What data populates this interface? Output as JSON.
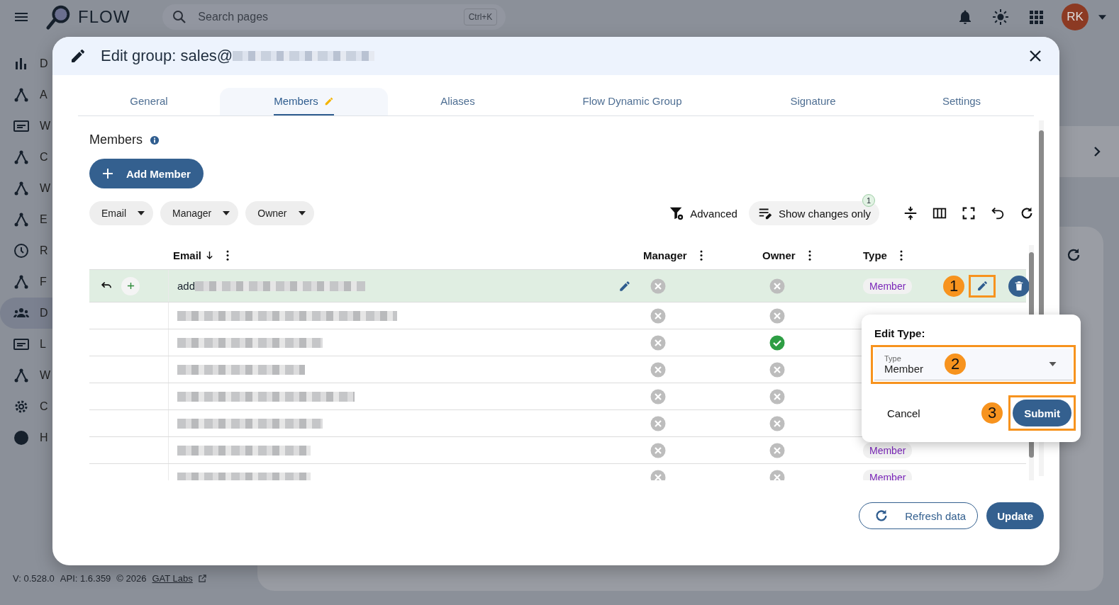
{
  "app_bar": {
    "brand": "FLOW",
    "search_placeholder": "Search pages",
    "shortcut": "Ctrl+K",
    "avatar": "RK"
  },
  "sidebar": {
    "items": [
      {
        "label": "D",
        "selected": false
      },
      {
        "label": "A",
        "selected": false
      },
      {
        "label": "W",
        "selected": false
      },
      {
        "label": "C",
        "selected": false
      },
      {
        "label": "W",
        "selected": false
      },
      {
        "label": "E",
        "selected": false
      },
      {
        "label": "R",
        "selected": false
      },
      {
        "label": "F",
        "selected": false
      },
      {
        "label": "D",
        "selected": true
      },
      {
        "label": "L",
        "selected": false
      },
      {
        "label": "W",
        "selected": false
      },
      {
        "label": "C",
        "selected": false
      },
      {
        "label": "H",
        "selected": false
      }
    ]
  },
  "footer": {
    "version": "V: 0.528.0",
    "api": "API: 1.6.359",
    "copyright": "© 2026",
    "link": "GAT Labs"
  },
  "dialog": {
    "title": "Edit group: sales@",
    "tabs": [
      {
        "label": "General",
        "selected": false,
        "edited": false
      },
      {
        "label": "Members",
        "selected": true,
        "edited": true
      },
      {
        "label": "Aliases",
        "selected": false,
        "edited": false
      },
      {
        "label": "Flow Dynamic Group",
        "selected": false,
        "edited": false
      },
      {
        "label": "Signature",
        "selected": false,
        "edited": false
      },
      {
        "label": "Settings",
        "selected": false,
        "edited": false
      }
    ],
    "section_title": "Members",
    "add_button": "Add Member",
    "filters": [
      "Email",
      "Manager",
      "Owner"
    ],
    "advanced": "Advanced",
    "changes_toggle": {
      "label": "Show changes only",
      "count": "1"
    },
    "table": {
      "columns": [
        {
          "label": "Email",
          "sorted": true
        },
        {
          "label": "Manager",
          "sorted": false
        },
        {
          "label": "Owner",
          "sorted": false
        },
        {
          "label": "Type",
          "sorted": false
        }
      ],
      "rows": [
        {
          "email": "add",
          "changed": true,
          "manager": false,
          "owner": false,
          "type": "Member"
        },
        {
          "changed": false,
          "manager": false,
          "owner": false
        },
        {
          "changed": false,
          "manager": false,
          "owner": true
        },
        {
          "changed": false,
          "manager": false,
          "owner": false
        },
        {
          "changed": false,
          "manager": false,
          "owner": false
        },
        {
          "changed": false,
          "manager": false,
          "owner": false
        },
        {
          "changed": false,
          "manager": false,
          "owner": false,
          "type": "Member"
        },
        {
          "changed": false,
          "manager": false,
          "owner": false,
          "type": "Member"
        }
      ]
    },
    "buttons": [
      "Refresh data",
      "Update"
    ]
  },
  "popover": {
    "title": "Edit Type:",
    "field_label": "Type",
    "value": "Member",
    "cancel": "Cancel",
    "submit": "Submit"
  },
  "annotations": [
    {
      "label": "1"
    },
    {
      "label": "2"
    },
    {
      "label": "3"
    }
  ]
}
